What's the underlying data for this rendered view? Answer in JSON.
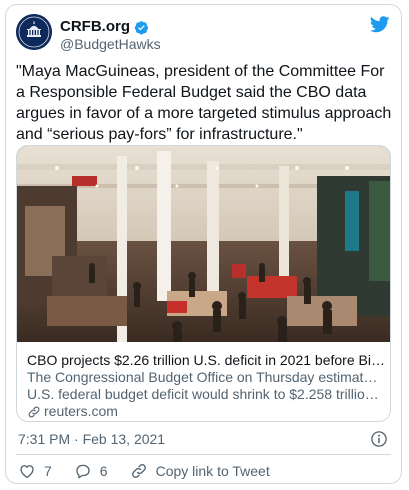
{
  "tweet": {
    "display_name": "CRFB.org",
    "handle": "@BudgetHawks",
    "text": "\"Maya MacGuineas, president of the Committee For a Responsible Federal Budget said the CBO data argues in favor of a more targeted stimulus approach and “serious pay-fors” for infrastructure.\"",
    "timestamp": "7:31 PM · Feb 13, 2021"
  },
  "link_card": {
    "title": "CBO projects $2.26 trillion U.S. deficit in 2021 before Biden s...",
    "description_line1": "The Congressional Budget Office on Thursday estimated the",
    "description_line2": "U.S. federal budget deficit would shrink to $2.258 trillion in ...",
    "domain": "reuters.com"
  },
  "actions": {
    "like_count": "7",
    "reply_count": "6",
    "copy_link_label": "Copy link to Tweet"
  },
  "colors": {
    "twitter_blue": "#1d9bf0",
    "secondary_text": "#536471",
    "border": "#cfd9de",
    "avatar_bg": "#0e2a5c"
  },
  "icons": [
    "verified-badge-icon",
    "twitter-bird-icon",
    "info-icon",
    "heart-icon",
    "reply-icon",
    "link-icon",
    "link-chain-icon"
  ]
}
